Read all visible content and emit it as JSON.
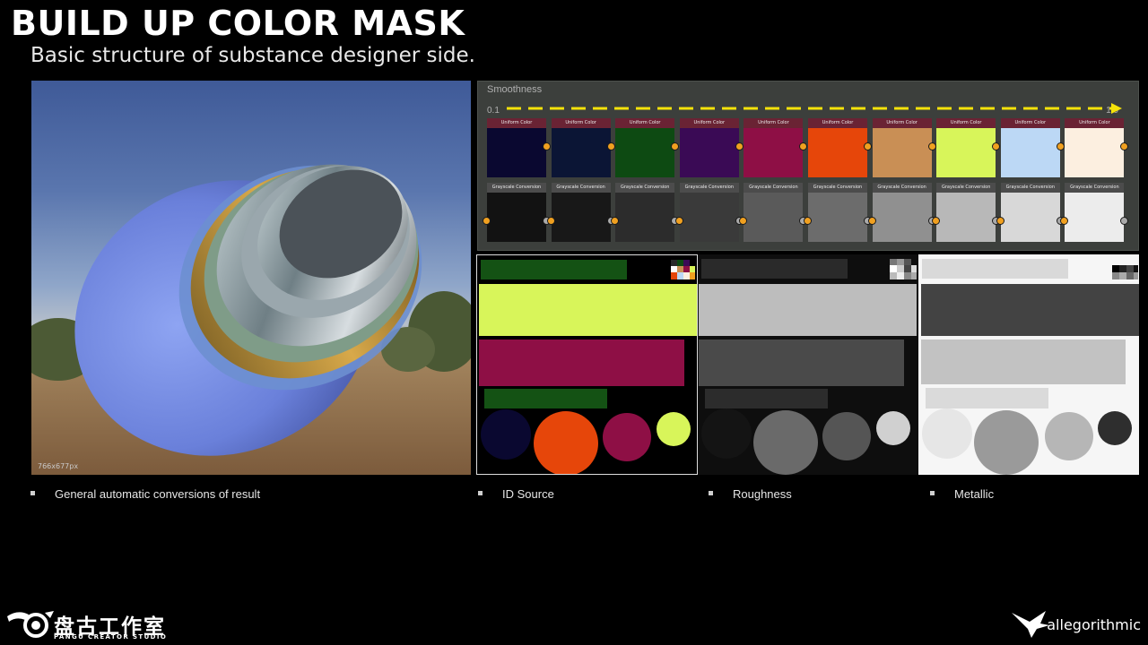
{
  "slide": {
    "title": "BUILD UP COLOR MASK",
    "subtitle": "Basic structure of substance designer side."
  },
  "render": {
    "caption": "766x677px"
  },
  "graph": {
    "label": "Smoothness",
    "range_min": "0.1",
    "range_max": "1.0",
    "uniform_node_title": "Uniform Color",
    "grayscale_node_title": "Grayscale Conversion",
    "uniform_colors": [
      "#0a0830",
      "#0b1535",
      "#0d4a12",
      "#3a0a55",
      "#8e0f45",
      "#e6460a",
      "#c98f55",
      "#d8f55a",
      "#bcd8f5",
      "#fcefe0"
    ],
    "grayscale_values": [
      "#121212",
      "#181818",
      "#2c2c2c",
      "#3a3a3a",
      "#5a5a5a",
      "#6c6c6c",
      "#909090",
      "#b8b8b8",
      "#d8d8d8",
      "#ececec"
    ],
    "accent": "#f0a020",
    "arrow_color": "#f5e20a"
  },
  "bullets": {
    "render": "General automatic conversions of result",
    "id_source": "ID Source",
    "roughness": "Roughness",
    "metallic": "Metallic"
  },
  "logos": {
    "left_cn": "盘古工作室",
    "left_en": "PANGU CREATOR STUDIO",
    "right": "allegorithmic"
  }
}
